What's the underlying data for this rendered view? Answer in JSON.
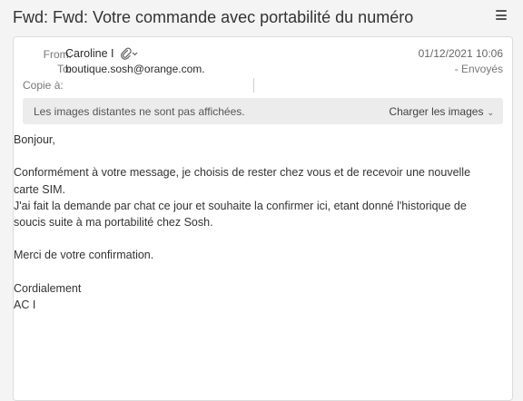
{
  "header": {
    "subject": "Fwd: Fwd: Votre commande avec portabilité du numéro",
    "menu_icon": "hamburger-menu-icon"
  },
  "message": {
    "from_label": "From:",
    "from_value": "Caroline I",
    "attachment_icon": "paperclip-icon",
    "to_label": "To:",
    "to_value": "boutique.sosh@orange.com.",
    "cc_label": "Copie à:",
    "date": "01/12/2021 10:06",
    "folder": "- Envoyés"
  },
  "notice": {
    "text": "Les images distantes ne sont pas affichées.",
    "button_label": "Charger les images",
    "button_icon": "chevron-down-icon"
  },
  "body": {
    "greeting": "Bonjour,",
    "para1_line1": "Conformément à votre message, je choisis de rester chez vous et de recevoir une nouvelle",
    "para1_line2": "carte SIM.",
    "para1_line3": "J'ai fait la demande par chat ce jour et souhaite la confirmer ici, etant donné l'historique de",
    "para1_line4": "soucis suite à ma portabilité chez Sosh.",
    "thanks": "Merci de votre confirmation.",
    "closing": "Cordialement",
    "signature": "AC I"
  },
  "colors": {
    "background": "#f4f4f4",
    "card": "#ffffff",
    "notice_bg": "#ececec",
    "muted_text": "#777777"
  }
}
